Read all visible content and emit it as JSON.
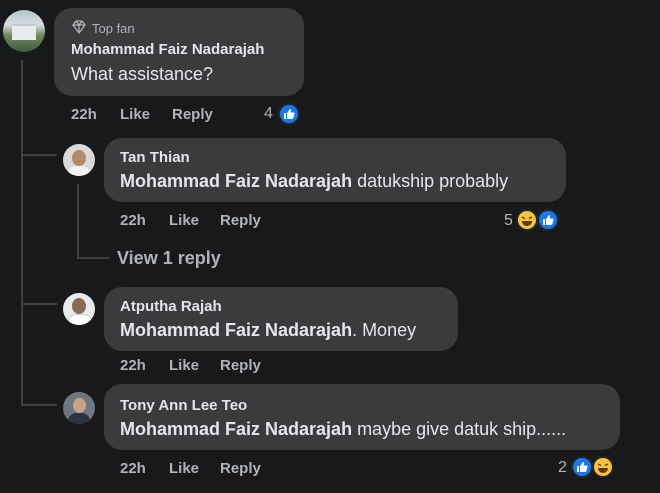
{
  "comment_main": {
    "badge": "Top fan",
    "author": "Mohammad Faiz Nadarajah",
    "text": "What assistance?",
    "time": "22h",
    "like": "Like",
    "reply": "Reply",
    "reaction_count": "4"
  },
  "replies": [
    {
      "author": "Tan Thian",
      "mention": "Mohammad Faiz Nadarajah",
      "text": " datukship probably",
      "time": "22h",
      "like": "Like",
      "reply": "Reply",
      "reaction_count": "5"
    },
    {
      "author": "Atputha Rajah",
      "mention": "Mohammad Faiz Nadarajah",
      "text": ". Money",
      "time": "22h",
      "like": "Like",
      "reply": "Reply"
    },
    {
      "author": "Tony Ann Lee Teo",
      "mention": "Mohammad Faiz Nadarajah",
      "text": " maybe give datuk ship......",
      "time": "22h",
      "like": "Like",
      "reply": "Reply",
      "reaction_count": "2"
    }
  ],
  "view_replies": "View 1 reply",
  "colors": {
    "background": "#18191a",
    "bubble": "#3a3b3c",
    "like_blue": "#1877f2",
    "haha_yellow": "#f7c53a"
  },
  "icons": [
    "diamond-icon",
    "like-reaction-icon",
    "haha-reaction-icon"
  ]
}
